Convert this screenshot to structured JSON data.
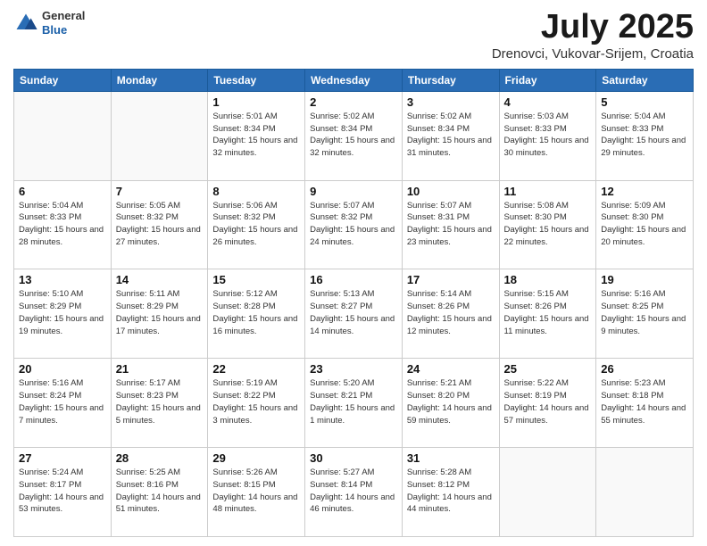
{
  "header": {
    "logo_general": "General",
    "logo_blue": "Blue",
    "title": "July 2025",
    "location": "Drenovci, Vukovar-Srijem, Croatia"
  },
  "days_of_week": [
    "Sunday",
    "Monday",
    "Tuesday",
    "Wednesday",
    "Thursday",
    "Friday",
    "Saturday"
  ],
  "weeks": [
    [
      {
        "day": null,
        "sunrise": null,
        "sunset": null,
        "daylight": null
      },
      {
        "day": null,
        "sunrise": null,
        "sunset": null,
        "daylight": null
      },
      {
        "day": "1",
        "sunrise": "Sunrise: 5:01 AM",
        "sunset": "Sunset: 8:34 PM",
        "daylight": "Daylight: 15 hours and 32 minutes."
      },
      {
        "day": "2",
        "sunrise": "Sunrise: 5:02 AM",
        "sunset": "Sunset: 8:34 PM",
        "daylight": "Daylight: 15 hours and 32 minutes."
      },
      {
        "day": "3",
        "sunrise": "Sunrise: 5:02 AM",
        "sunset": "Sunset: 8:34 PM",
        "daylight": "Daylight: 15 hours and 31 minutes."
      },
      {
        "day": "4",
        "sunrise": "Sunrise: 5:03 AM",
        "sunset": "Sunset: 8:33 PM",
        "daylight": "Daylight: 15 hours and 30 minutes."
      },
      {
        "day": "5",
        "sunrise": "Sunrise: 5:04 AM",
        "sunset": "Sunset: 8:33 PM",
        "daylight": "Daylight: 15 hours and 29 minutes."
      }
    ],
    [
      {
        "day": "6",
        "sunrise": "Sunrise: 5:04 AM",
        "sunset": "Sunset: 8:33 PM",
        "daylight": "Daylight: 15 hours and 28 minutes."
      },
      {
        "day": "7",
        "sunrise": "Sunrise: 5:05 AM",
        "sunset": "Sunset: 8:32 PM",
        "daylight": "Daylight: 15 hours and 27 minutes."
      },
      {
        "day": "8",
        "sunrise": "Sunrise: 5:06 AM",
        "sunset": "Sunset: 8:32 PM",
        "daylight": "Daylight: 15 hours and 26 minutes."
      },
      {
        "day": "9",
        "sunrise": "Sunrise: 5:07 AM",
        "sunset": "Sunset: 8:32 PM",
        "daylight": "Daylight: 15 hours and 24 minutes."
      },
      {
        "day": "10",
        "sunrise": "Sunrise: 5:07 AM",
        "sunset": "Sunset: 8:31 PM",
        "daylight": "Daylight: 15 hours and 23 minutes."
      },
      {
        "day": "11",
        "sunrise": "Sunrise: 5:08 AM",
        "sunset": "Sunset: 8:30 PM",
        "daylight": "Daylight: 15 hours and 22 minutes."
      },
      {
        "day": "12",
        "sunrise": "Sunrise: 5:09 AM",
        "sunset": "Sunset: 8:30 PM",
        "daylight": "Daylight: 15 hours and 20 minutes."
      }
    ],
    [
      {
        "day": "13",
        "sunrise": "Sunrise: 5:10 AM",
        "sunset": "Sunset: 8:29 PM",
        "daylight": "Daylight: 15 hours and 19 minutes."
      },
      {
        "day": "14",
        "sunrise": "Sunrise: 5:11 AM",
        "sunset": "Sunset: 8:29 PM",
        "daylight": "Daylight: 15 hours and 17 minutes."
      },
      {
        "day": "15",
        "sunrise": "Sunrise: 5:12 AM",
        "sunset": "Sunset: 8:28 PM",
        "daylight": "Daylight: 15 hours and 16 minutes."
      },
      {
        "day": "16",
        "sunrise": "Sunrise: 5:13 AM",
        "sunset": "Sunset: 8:27 PM",
        "daylight": "Daylight: 15 hours and 14 minutes."
      },
      {
        "day": "17",
        "sunrise": "Sunrise: 5:14 AM",
        "sunset": "Sunset: 8:26 PM",
        "daylight": "Daylight: 15 hours and 12 minutes."
      },
      {
        "day": "18",
        "sunrise": "Sunrise: 5:15 AM",
        "sunset": "Sunset: 8:26 PM",
        "daylight": "Daylight: 15 hours and 11 minutes."
      },
      {
        "day": "19",
        "sunrise": "Sunrise: 5:16 AM",
        "sunset": "Sunset: 8:25 PM",
        "daylight": "Daylight: 15 hours and 9 minutes."
      }
    ],
    [
      {
        "day": "20",
        "sunrise": "Sunrise: 5:16 AM",
        "sunset": "Sunset: 8:24 PM",
        "daylight": "Daylight: 15 hours and 7 minutes."
      },
      {
        "day": "21",
        "sunrise": "Sunrise: 5:17 AM",
        "sunset": "Sunset: 8:23 PM",
        "daylight": "Daylight: 15 hours and 5 minutes."
      },
      {
        "day": "22",
        "sunrise": "Sunrise: 5:19 AM",
        "sunset": "Sunset: 8:22 PM",
        "daylight": "Daylight: 15 hours and 3 minutes."
      },
      {
        "day": "23",
        "sunrise": "Sunrise: 5:20 AM",
        "sunset": "Sunset: 8:21 PM",
        "daylight": "Daylight: 15 hours and 1 minute."
      },
      {
        "day": "24",
        "sunrise": "Sunrise: 5:21 AM",
        "sunset": "Sunset: 8:20 PM",
        "daylight": "Daylight: 14 hours and 59 minutes."
      },
      {
        "day": "25",
        "sunrise": "Sunrise: 5:22 AM",
        "sunset": "Sunset: 8:19 PM",
        "daylight": "Daylight: 14 hours and 57 minutes."
      },
      {
        "day": "26",
        "sunrise": "Sunrise: 5:23 AM",
        "sunset": "Sunset: 8:18 PM",
        "daylight": "Daylight: 14 hours and 55 minutes."
      }
    ],
    [
      {
        "day": "27",
        "sunrise": "Sunrise: 5:24 AM",
        "sunset": "Sunset: 8:17 PM",
        "daylight": "Daylight: 14 hours and 53 minutes."
      },
      {
        "day": "28",
        "sunrise": "Sunrise: 5:25 AM",
        "sunset": "Sunset: 8:16 PM",
        "daylight": "Daylight: 14 hours and 51 minutes."
      },
      {
        "day": "29",
        "sunrise": "Sunrise: 5:26 AM",
        "sunset": "Sunset: 8:15 PM",
        "daylight": "Daylight: 14 hours and 48 minutes."
      },
      {
        "day": "30",
        "sunrise": "Sunrise: 5:27 AM",
        "sunset": "Sunset: 8:14 PM",
        "daylight": "Daylight: 14 hours and 46 minutes."
      },
      {
        "day": "31",
        "sunrise": "Sunrise: 5:28 AM",
        "sunset": "Sunset: 8:12 PM",
        "daylight": "Daylight: 14 hours and 44 minutes."
      },
      {
        "day": null,
        "sunrise": null,
        "sunset": null,
        "daylight": null
      },
      {
        "day": null,
        "sunrise": null,
        "sunset": null,
        "daylight": null
      }
    ]
  ]
}
